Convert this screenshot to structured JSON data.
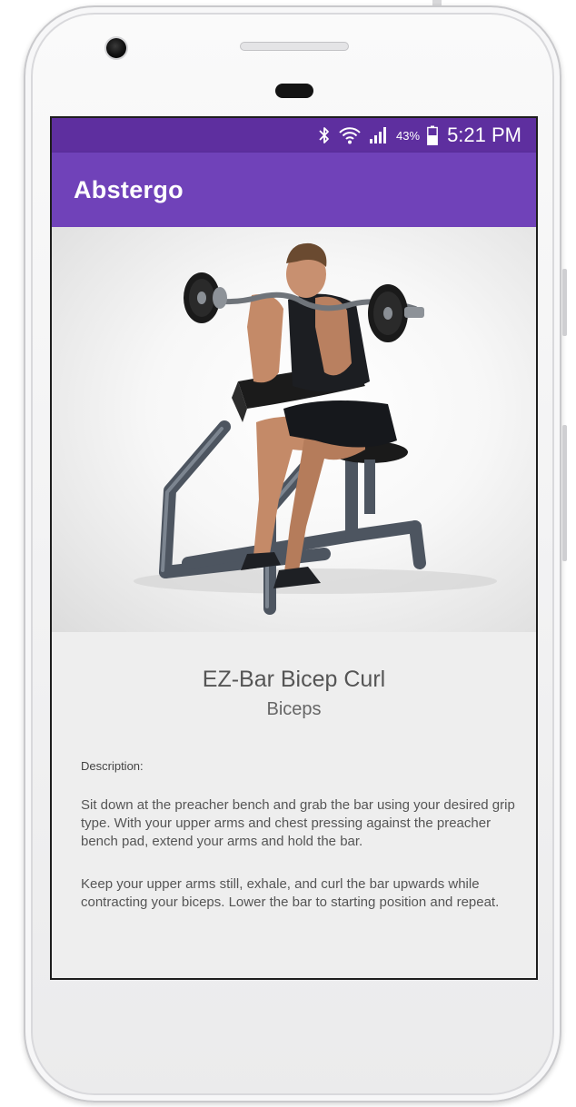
{
  "status_bar": {
    "battery_percent": "43%",
    "time": "5:21 PM",
    "icons": [
      "bluetooth-icon",
      "wifi-icon",
      "signal-icon",
      "battery-icon"
    ]
  },
  "app_bar": {
    "title": "Abstergo"
  },
  "exercise": {
    "name": "EZ-Bar Bicep Curl",
    "muscle": "Biceps",
    "description_label": "Description:",
    "description_paragraphs": [
      "Sit down at the preacher bench and grab the bar using your desired grip type. With your upper arms and chest pressing against the preacher bench pad, extend your arms and hold the bar.",
      "Keep your upper arms still, exhale, and curl the bar upwards while contracting your biceps. Lower the bar to starting position and repeat."
    ]
  },
  "colors": {
    "status_bar": "#5e2f9f",
    "app_bar": "#7042b9",
    "screen_background": "#eeeeee"
  }
}
